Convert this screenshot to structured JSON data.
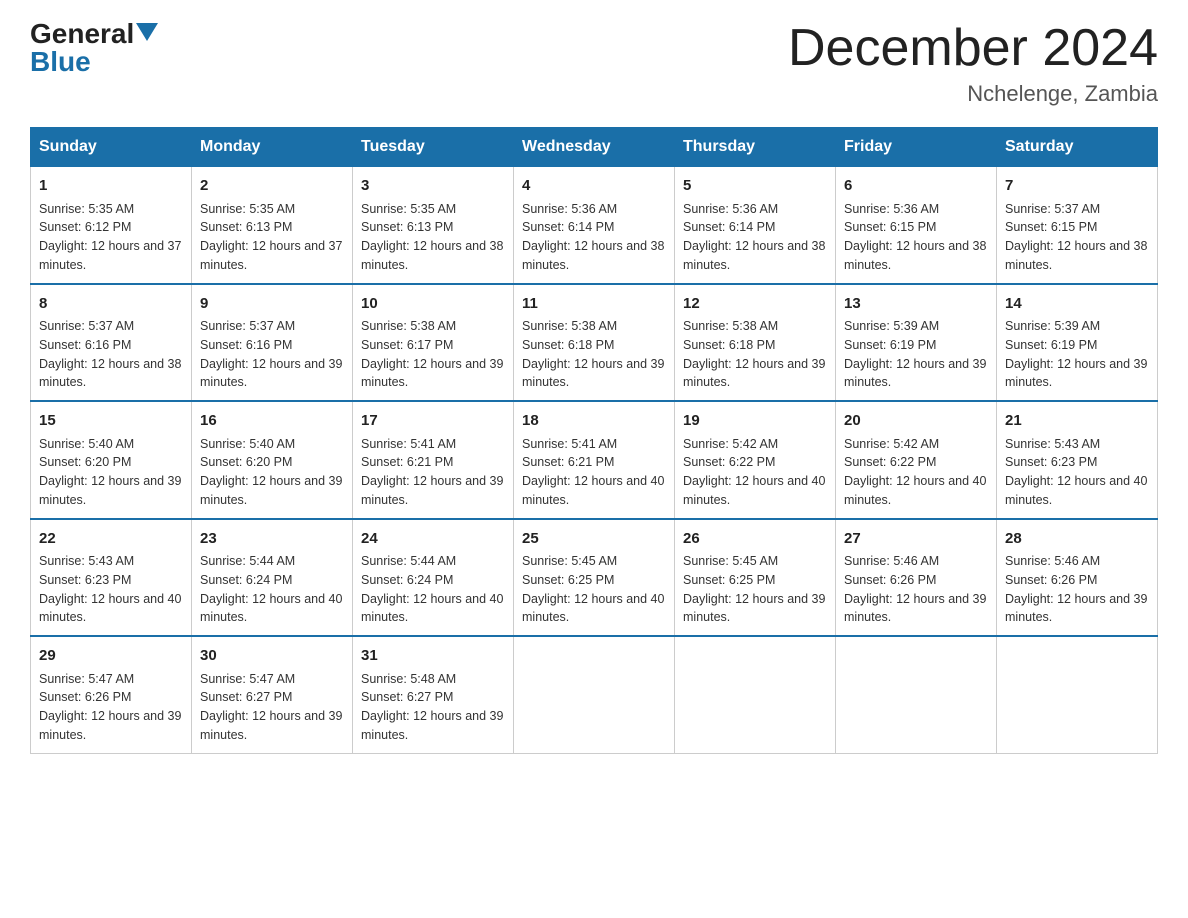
{
  "header": {
    "logo_general": "General",
    "logo_blue": "Blue",
    "month_title": "December 2024",
    "subtitle": "Nchelenge, Zambia"
  },
  "days_of_week": [
    "Sunday",
    "Monday",
    "Tuesday",
    "Wednesday",
    "Thursday",
    "Friday",
    "Saturday"
  ],
  "weeks": [
    [
      {
        "day": "1",
        "sunrise": "5:35 AM",
        "sunset": "6:12 PM",
        "daylight": "12 hours and 37 minutes."
      },
      {
        "day": "2",
        "sunrise": "5:35 AM",
        "sunset": "6:13 PM",
        "daylight": "12 hours and 37 minutes."
      },
      {
        "day": "3",
        "sunrise": "5:35 AM",
        "sunset": "6:13 PM",
        "daylight": "12 hours and 38 minutes."
      },
      {
        "day": "4",
        "sunrise": "5:36 AM",
        "sunset": "6:14 PM",
        "daylight": "12 hours and 38 minutes."
      },
      {
        "day": "5",
        "sunrise": "5:36 AM",
        "sunset": "6:14 PM",
        "daylight": "12 hours and 38 minutes."
      },
      {
        "day": "6",
        "sunrise": "5:36 AM",
        "sunset": "6:15 PM",
        "daylight": "12 hours and 38 minutes."
      },
      {
        "day": "7",
        "sunrise": "5:37 AM",
        "sunset": "6:15 PM",
        "daylight": "12 hours and 38 minutes."
      }
    ],
    [
      {
        "day": "8",
        "sunrise": "5:37 AM",
        "sunset": "6:16 PM",
        "daylight": "12 hours and 38 minutes."
      },
      {
        "day": "9",
        "sunrise": "5:37 AM",
        "sunset": "6:16 PM",
        "daylight": "12 hours and 39 minutes."
      },
      {
        "day": "10",
        "sunrise": "5:38 AM",
        "sunset": "6:17 PM",
        "daylight": "12 hours and 39 minutes."
      },
      {
        "day": "11",
        "sunrise": "5:38 AM",
        "sunset": "6:18 PM",
        "daylight": "12 hours and 39 minutes."
      },
      {
        "day": "12",
        "sunrise": "5:38 AM",
        "sunset": "6:18 PM",
        "daylight": "12 hours and 39 minutes."
      },
      {
        "day": "13",
        "sunrise": "5:39 AM",
        "sunset": "6:19 PM",
        "daylight": "12 hours and 39 minutes."
      },
      {
        "day": "14",
        "sunrise": "5:39 AM",
        "sunset": "6:19 PM",
        "daylight": "12 hours and 39 minutes."
      }
    ],
    [
      {
        "day": "15",
        "sunrise": "5:40 AM",
        "sunset": "6:20 PM",
        "daylight": "12 hours and 39 minutes."
      },
      {
        "day": "16",
        "sunrise": "5:40 AM",
        "sunset": "6:20 PM",
        "daylight": "12 hours and 39 minutes."
      },
      {
        "day": "17",
        "sunrise": "5:41 AM",
        "sunset": "6:21 PM",
        "daylight": "12 hours and 39 minutes."
      },
      {
        "day": "18",
        "sunrise": "5:41 AM",
        "sunset": "6:21 PM",
        "daylight": "12 hours and 40 minutes."
      },
      {
        "day": "19",
        "sunrise": "5:42 AM",
        "sunset": "6:22 PM",
        "daylight": "12 hours and 40 minutes."
      },
      {
        "day": "20",
        "sunrise": "5:42 AM",
        "sunset": "6:22 PM",
        "daylight": "12 hours and 40 minutes."
      },
      {
        "day": "21",
        "sunrise": "5:43 AM",
        "sunset": "6:23 PM",
        "daylight": "12 hours and 40 minutes."
      }
    ],
    [
      {
        "day": "22",
        "sunrise": "5:43 AM",
        "sunset": "6:23 PM",
        "daylight": "12 hours and 40 minutes."
      },
      {
        "day": "23",
        "sunrise": "5:44 AM",
        "sunset": "6:24 PM",
        "daylight": "12 hours and 40 minutes."
      },
      {
        "day": "24",
        "sunrise": "5:44 AM",
        "sunset": "6:24 PM",
        "daylight": "12 hours and 40 minutes."
      },
      {
        "day": "25",
        "sunrise": "5:45 AM",
        "sunset": "6:25 PM",
        "daylight": "12 hours and 40 minutes."
      },
      {
        "day": "26",
        "sunrise": "5:45 AM",
        "sunset": "6:25 PM",
        "daylight": "12 hours and 39 minutes."
      },
      {
        "day": "27",
        "sunrise": "5:46 AM",
        "sunset": "6:26 PM",
        "daylight": "12 hours and 39 minutes."
      },
      {
        "day": "28",
        "sunrise": "5:46 AM",
        "sunset": "6:26 PM",
        "daylight": "12 hours and 39 minutes."
      }
    ],
    [
      {
        "day": "29",
        "sunrise": "5:47 AM",
        "sunset": "6:26 PM",
        "daylight": "12 hours and 39 minutes."
      },
      {
        "day": "30",
        "sunrise": "5:47 AM",
        "sunset": "6:27 PM",
        "daylight": "12 hours and 39 minutes."
      },
      {
        "day": "31",
        "sunrise": "5:48 AM",
        "sunset": "6:27 PM",
        "daylight": "12 hours and 39 minutes."
      },
      null,
      null,
      null,
      null
    ]
  ]
}
